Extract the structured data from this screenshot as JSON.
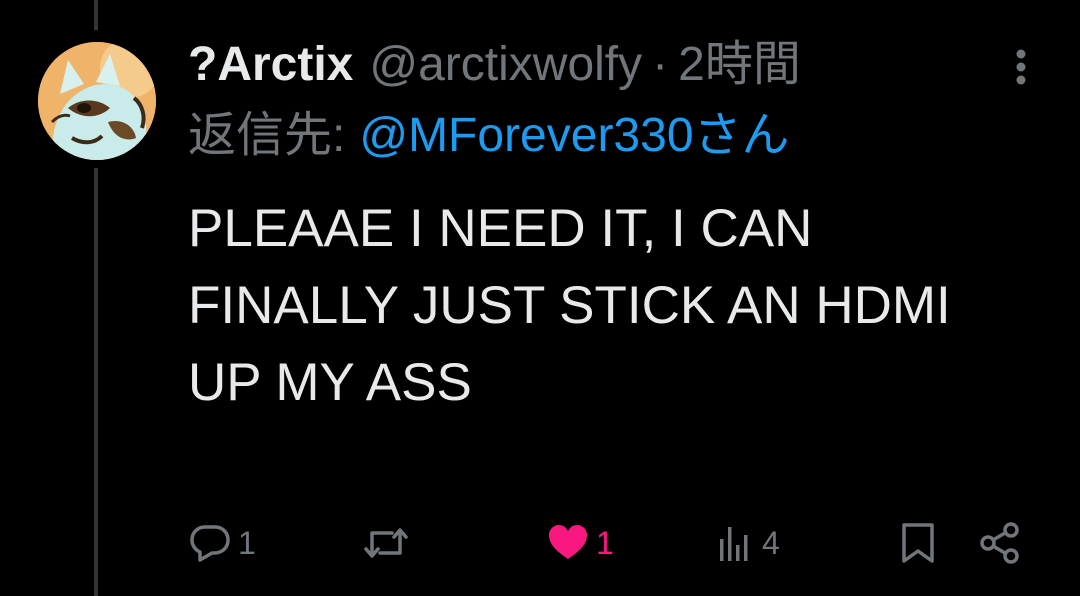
{
  "post": {
    "display_name": "?Arctix",
    "handle": "@arctixwolfy",
    "separator": "·",
    "time": "2時間",
    "reply_prefix": "返信先:",
    "reply_to": "@MForever330さん",
    "text_lines": [
      "PLEAAE I NEED IT, I CAN",
      "FINALLY JUST STICK AN HDMI",
      "UP MY ASS"
    ]
  },
  "actions": {
    "reply_count": "1",
    "like_count": "1",
    "views_count": "4",
    "icons": {
      "reply": "speech-bubble-icon",
      "repost": "repost-arrows-icon",
      "like": "heart-icon",
      "views": "bar-chart-icon",
      "bookmark": "bookmark-icon",
      "share": "share-icon",
      "more": "more-vertical-icon"
    }
  },
  "colors": {
    "background": "#000000",
    "primary_text": "#e7e9ea",
    "secondary_text": "#71767b",
    "link": "#1d9bf0",
    "like_active": "#f91880",
    "thread_line": "#333639"
  }
}
